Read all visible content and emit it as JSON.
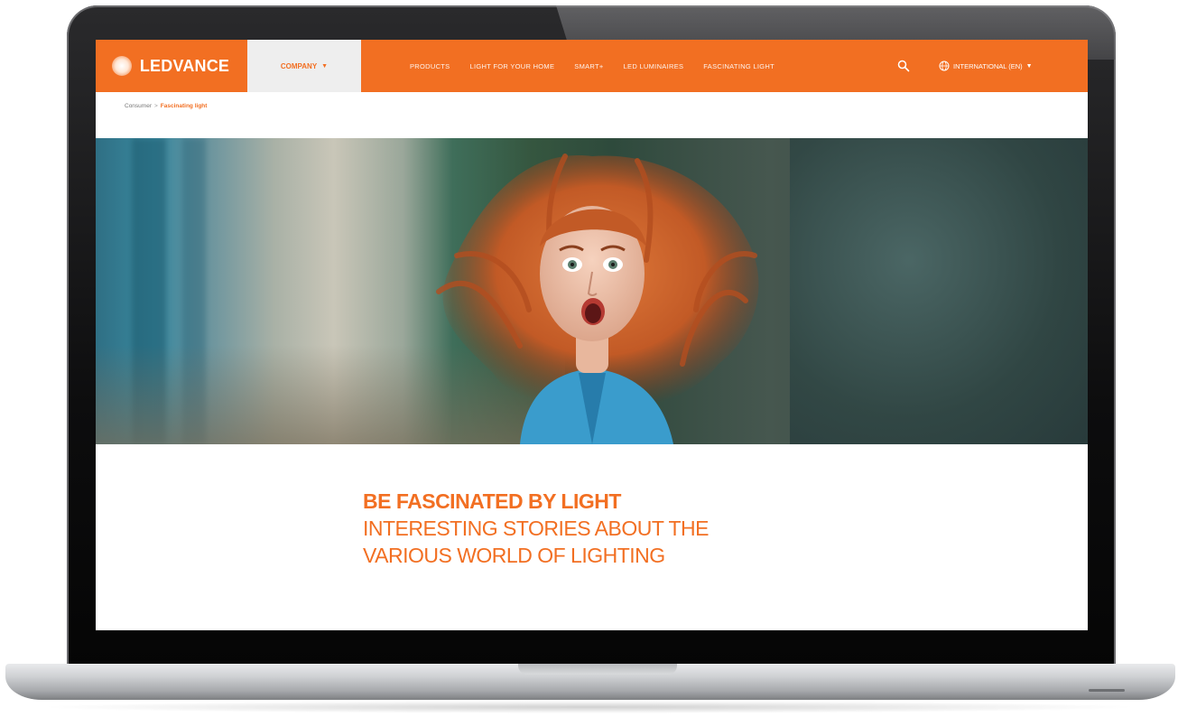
{
  "site": {
    "brand": "LEDVANCE",
    "brand_color": "#f26f22",
    "company_menu": "COMPANY",
    "nav": [
      "PRODUCTS",
      "LIGHT FOR YOUR HOME",
      "SMART+",
      "LED LUMINAIRES",
      "FASCINATING LIGHT"
    ],
    "language": "INTERNATIONAL (EN)"
  },
  "breadcrumb": {
    "home": "Consumer",
    "separator": ">",
    "current": "Fascinating light"
  },
  "hero": {
    "image": "woman-with-flying-red-hair-photo"
  },
  "content": {
    "title": "BE FASCINATED BY LIGHT",
    "subtitle_line1": "INTERESTING STORIES ABOUT THE",
    "subtitle_line2": "VARIOUS WORLD OF LIGHTING"
  },
  "icons": {
    "search": "search-icon",
    "globe": "globe-icon",
    "caret": "chevron-down-icon"
  }
}
